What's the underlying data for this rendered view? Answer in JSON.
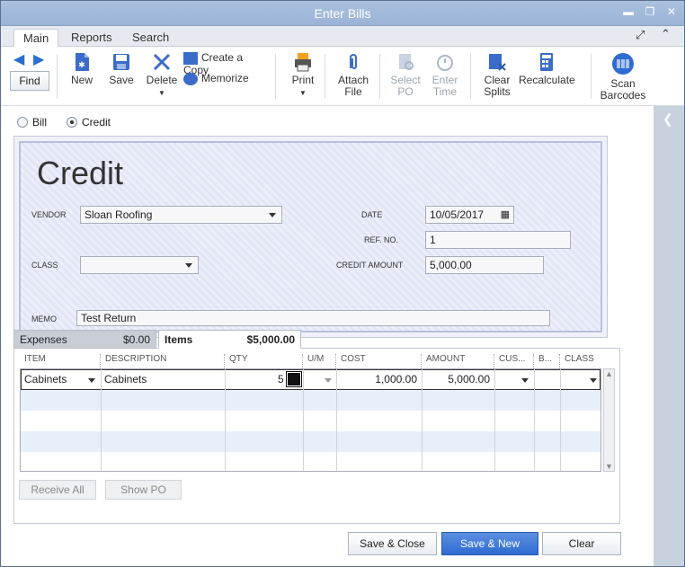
{
  "window": {
    "title": "Enter Bills"
  },
  "tabs": [
    {
      "label": "Main"
    },
    {
      "label": "Reports"
    },
    {
      "label": "Search"
    }
  ],
  "toolbar": {
    "find": "Find",
    "new": "New",
    "save": "Save",
    "delete": "Delete",
    "create_copy": "Create a Copy",
    "memorize": "Memorize",
    "print": "Print",
    "attach_file": [
      "Attach",
      "File"
    ],
    "select_po": [
      "Select",
      "PO"
    ],
    "enter_time": [
      "Enter",
      "Time"
    ],
    "clear_splits": [
      "Clear",
      "Splits"
    ],
    "recalculate": "Recalculate",
    "scan_barcodes": [
      "Scan",
      "Barcodes"
    ]
  },
  "mode": {
    "bill": "Bill",
    "credit": "Credit",
    "selected": "credit"
  },
  "form": {
    "heading": "Credit",
    "vendor_label": "VENDOR",
    "vendor": "Sloan Roofing",
    "date_label": "DATE",
    "date": "10/05/2017",
    "ref_label": "REF. NO.",
    "ref": "1",
    "class_label": "CLASS",
    "class": "",
    "credit_amount_label": "CREDIT AMOUNT",
    "credit_amount": "5,000.00",
    "memo_label": "MEMO",
    "memo": "Test Return"
  },
  "detail_tabs": [
    {
      "label": "Expenses",
      "amount": "$0.00"
    },
    {
      "label": "Items",
      "amount": "$5,000.00"
    }
  ],
  "columns": [
    "ITEM",
    "DESCRIPTION",
    "QTY",
    "U/M",
    "COST",
    "AMOUNT",
    "CUS...",
    "B...",
    "CLASS"
  ],
  "items": [
    {
      "item": "Cabinets",
      "description": "Cabinets",
      "qty": "5",
      "um": "",
      "cost": "1,000.00",
      "amount": "5,000.00",
      "customer": "",
      "billable": "",
      "class": ""
    }
  ],
  "grid_buttons": {
    "receive_all": "Receive All",
    "show_po": "Show PO"
  },
  "actions": {
    "save_close": "Save & Close",
    "save_new": "Save & New",
    "clear": "Clear"
  },
  "colors": {
    "title_bar": "#9bb4d6",
    "primary_button": "#2e6bd2",
    "row_alt": "#e6effa"
  }
}
